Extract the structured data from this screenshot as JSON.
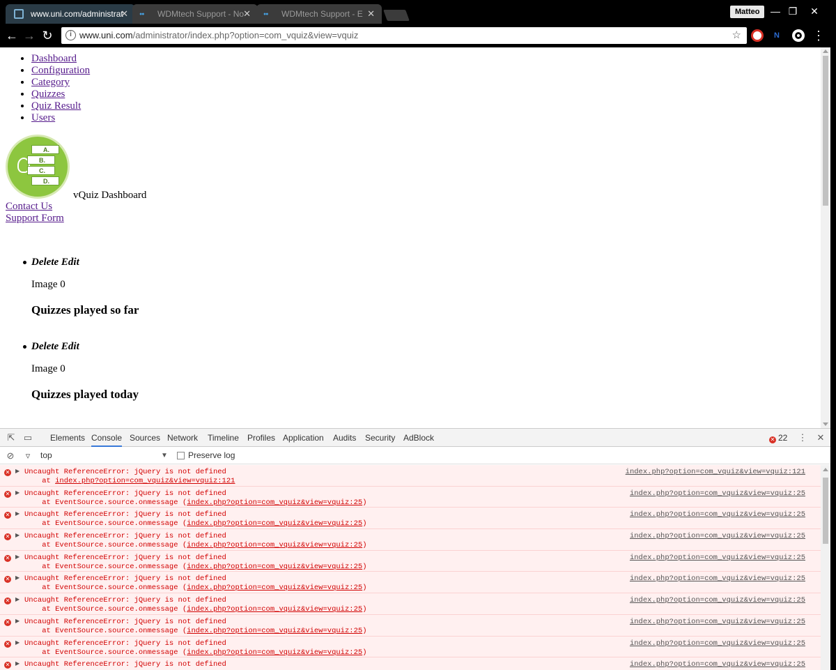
{
  "browser": {
    "tabs": [
      {
        "title": "www.uni.com/administrat",
        "active": true
      },
      {
        "title": "WDMtech Support - No",
        "active": false
      },
      {
        "title": "WDMtech Support - E",
        "active": false
      }
    ],
    "profile_name": "Matteo",
    "window_controls": {
      "minimize": "—",
      "restore": "❐",
      "close": "✕"
    },
    "url_host": "www.uni.com",
    "url_path": "/administrator/index.php?option=com_vquiz&view=vquiz",
    "icons": {
      "back": "←",
      "forward": "→",
      "reload": "↻",
      "bookmark": "☆",
      "menu": "⋮",
      "tab_close": "✕"
    }
  },
  "page": {
    "nav": [
      "Dashboard",
      "Configuration",
      "Category",
      "Quizzes",
      "Quiz Result",
      "Users"
    ],
    "logo_options": [
      "A.",
      "B.",
      "C.",
      "D."
    ],
    "dashboard_title": "vQuiz Dashboard",
    "side_links": [
      "Contact Us",
      "Support Form"
    ],
    "blocks": [
      {
        "actions": "Delete Edit",
        "image_label": "Image 0",
        "heading": "Quizzes played so far"
      },
      {
        "actions": "Delete Edit",
        "image_label": "Image 0",
        "heading": "Quizzes played today"
      }
    ]
  },
  "devtools": {
    "tabs": [
      "Elements",
      "Console",
      "Sources",
      "Network",
      "Timeline",
      "Profiles",
      "Application",
      "Audits",
      "Security",
      "AdBlock"
    ],
    "active_tab": "Console",
    "error_count": "22",
    "context": "top",
    "preserve_log_label": "Preserve log",
    "messages": [
      {
        "text": "Uncaught ReferenceError: jQuery is not defined",
        "stack_prefix": "    at ",
        "stack_link": "index.php?option=com_vquiz&view=vquiz:121",
        "stack_suffix": "",
        "source": "index.php?option=com_vquiz&view=vquiz:121"
      },
      {
        "text": "Uncaught ReferenceError: jQuery is not defined",
        "stack_prefix": "    at EventSource.source.onmessage (",
        "stack_link": "index.php?option=com_vquiz&view=vquiz:25",
        "stack_suffix": ")",
        "source": "index.php?option=com_vquiz&view=vquiz:25"
      },
      {
        "text": "Uncaught ReferenceError: jQuery is not defined",
        "stack_prefix": "    at EventSource.source.onmessage (",
        "stack_link": "index.php?option=com_vquiz&view=vquiz:25",
        "stack_suffix": ")",
        "source": "index.php?option=com_vquiz&view=vquiz:25"
      },
      {
        "text": "Uncaught ReferenceError: jQuery is not defined",
        "stack_prefix": "    at EventSource.source.onmessage (",
        "stack_link": "index.php?option=com_vquiz&view=vquiz:25",
        "stack_suffix": ")",
        "source": "index.php?option=com_vquiz&view=vquiz:25"
      },
      {
        "text": "Uncaught ReferenceError: jQuery is not defined",
        "stack_prefix": "    at EventSource.source.onmessage (",
        "stack_link": "index.php?option=com_vquiz&view=vquiz:25",
        "stack_suffix": ")",
        "source": "index.php?option=com_vquiz&view=vquiz:25"
      },
      {
        "text": "Uncaught ReferenceError: jQuery is not defined",
        "stack_prefix": "    at EventSource.source.onmessage (",
        "stack_link": "index.php?option=com_vquiz&view=vquiz:25",
        "stack_suffix": ")",
        "source": "index.php?option=com_vquiz&view=vquiz:25"
      },
      {
        "text": "Uncaught ReferenceError: jQuery is not defined",
        "stack_prefix": "    at EventSource.source.onmessage (",
        "stack_link": "index.php?option=com_vquiz&view=vquiz:25",
        "stack_suffix": ")",
        "source": "index.php?option=com_vquiz&view=vquiz:25"
      },
      {
        "text": "Uncaught ReferenceError: jQuery is not defined",
        "stack_prefix": "    at EventSource.source.onmessage (",
        "stack_link": "index.php?option=com_vquiz&view=vquiz:25",
        "stack_suffix": ")",
        "source": "index.php?option=com_vquiz&view=vquiz:25"
      },
      {
        "text": "Uncaught ReferenceError: jQuery is not defined",
        "stack_prefix": "    at EventSource.source.onmessage (",
        "stack_link": "index.php?option=com_vquiz&view=vquiz:25",
        "stack_suffix": ")",
        "source": "index.php?option=com_vquiz&view=vquiz:25"
      },
      {
        "text": "Uncaught ReferenceError: jQuery is not defined",
        "stack_prefix": "",
        "stack_link": "",
        "stack_suffix": "",
        "source": "index.php?option=com_vquiz&view=vquiz:25"
      }
    ]
  },
  "colors": {
    "error_red": "#d20000",
    "error_bg": "#fff0f0",
    "link_visited": "#551a8b",
    "logo_green": "#8dc63f",
    "active_tab": "#2a3b46"
  }
}
